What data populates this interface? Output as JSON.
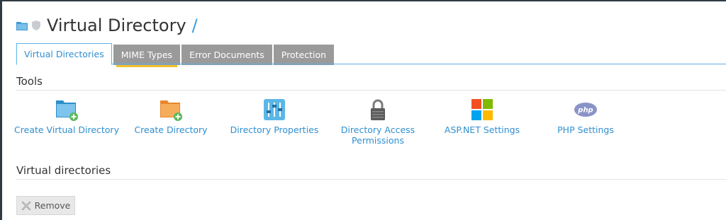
{
  "header": {
    "title": "Virtual Directory",
    "path_slash": "/",
    "icons": [
      "folder-icon",
      "shield-icon"
    ]
  },
  "tabs": [
    {
      "label": "Virtual Directories",
      "active": true
    },
    {
      "label": "MIME Types",
      "active": false
    },
    {
      "label": "Error Documents",
      "active": false
    },
    {
      "label": "Protection",
      "active": false
    }
  ],
  "tools": {
    "title": "Tools",
    "items": [
      {
        "label": "Create Virtual Directory",
        "icon": "folder-add-icon"
      },
      {
        "label": "Create Directory",
        "icon": "folder-add-icon"
      },
      {
        "label": "Directory Properties",
        "icon": "sliders-icon"
      },
      {
        "label": "Directory Access Permissions",
        "icon": "lock-icon"
      },
      {
        "label": "ASP.NET Settings",
        "icon": "windows-logo-icon"
      },
      {
        "label": "PHP Settings",
        "icon": "php-logo-icon"
      }
    ]
  },
  "virtual_directories": {
    "title": "Virtual directories",
    "remove_label": "Remove"
  },
  "colors": {
    "accent": "#2f8fd0",
    "tab_inactive": "#9a9a9a",
    "tab_highlight": "#f2c12e",
    "text": "#333333"
  }
}
